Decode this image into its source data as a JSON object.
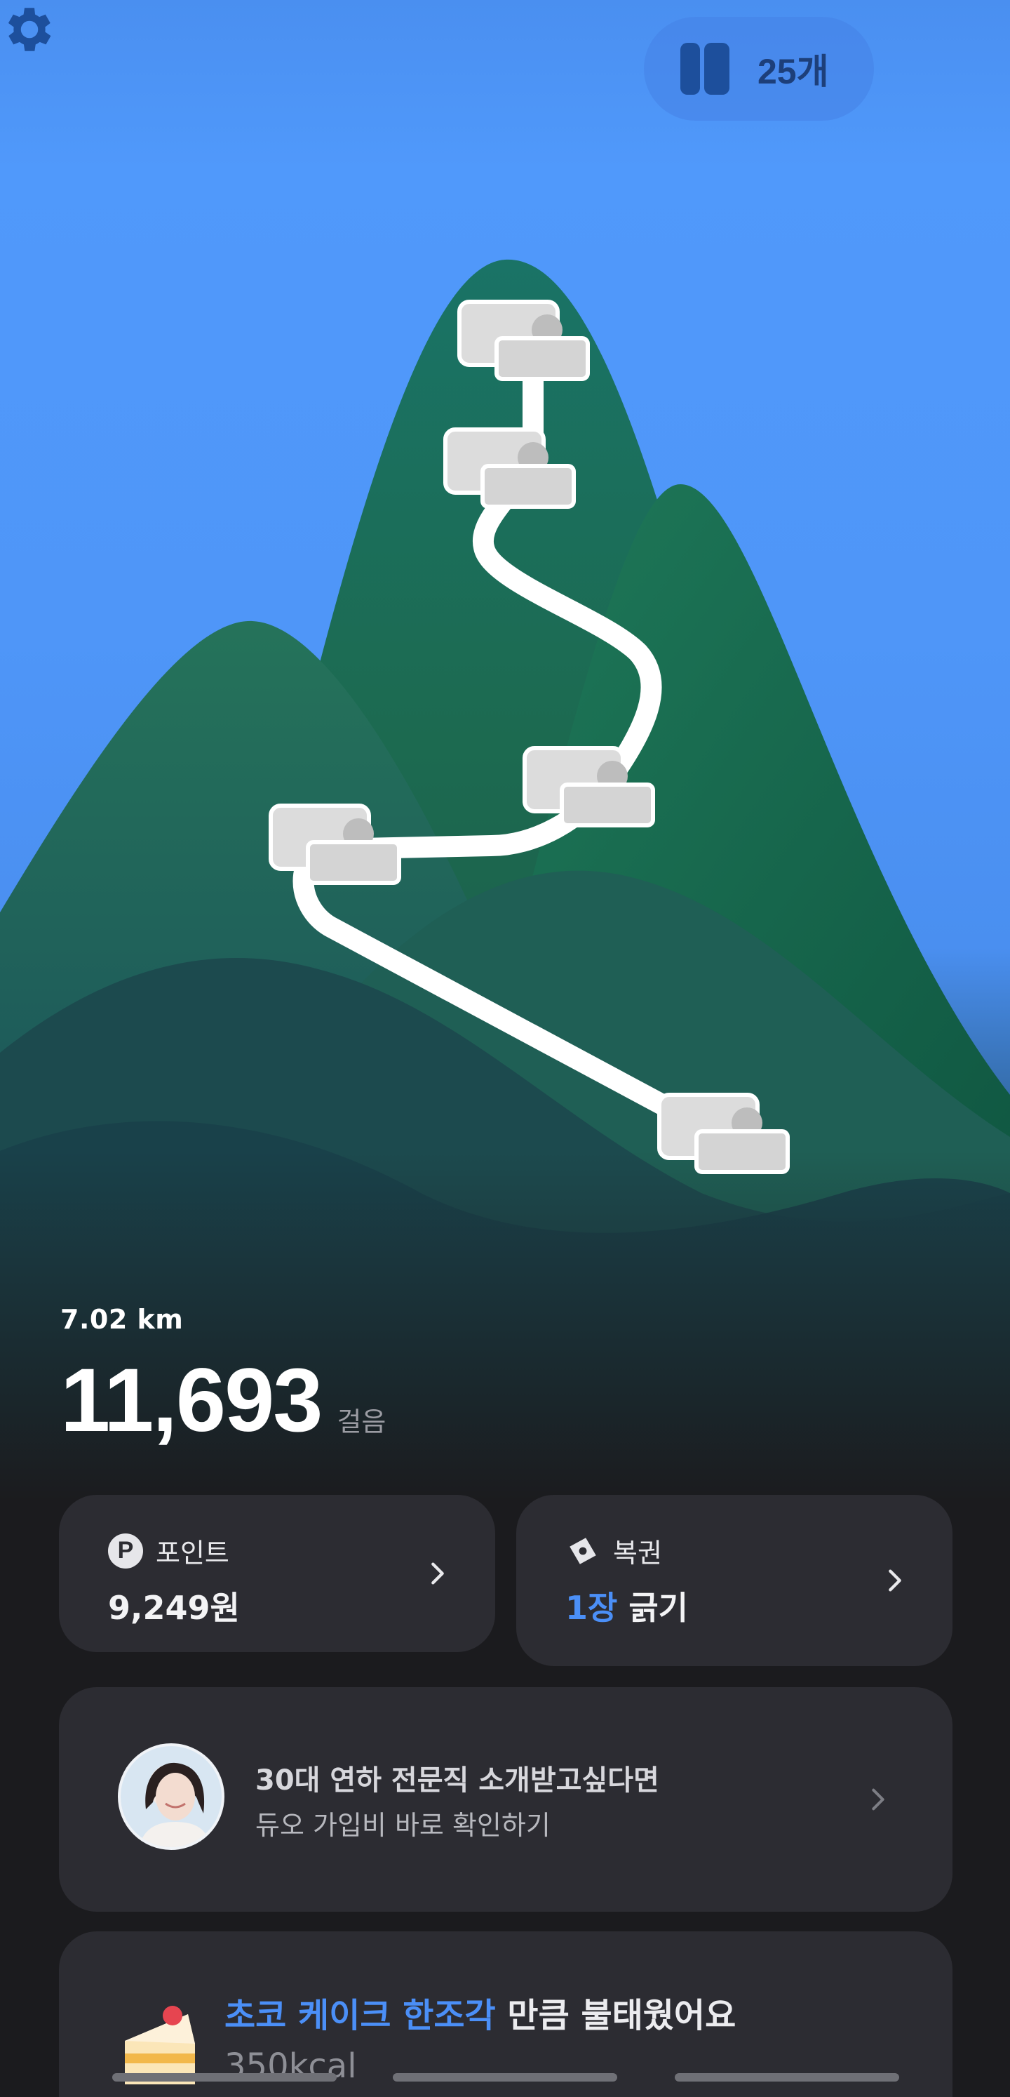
{
  "header": {
    "ticket_count": "25개",
    "icons": {
      "ticket": "ticket-stack-icon",
      "settings": "gear-icon"
    }
  },
  "activity": {
    "distance": "7.02 km",
    "steps": "11,693",
    "steps_unit": "걸음"
  },
  "points_card": {
    "icon": "point-badge-icon",
    "badge": "P",
    "label": "포인트",
    "value": "9,249원"
  },
  "lottery_card": {
    "icon": "lottery-ticket-icon",
    "label": "복권",
    "count": "1장",
    "action": "긁기"
  },
  "ad_card": {
    "title": "30대 연하 전문직 소개받고싶다면",
    "subtitle": "듀오 가입비 바로 확인하기"
  },
  "calorie_card": {
    "icon": "cake-icon",
    "food_highlight": "초코 케이크 한조각",
    "suffix": " 만큼 불태웠어요",
    "kcal": "350kcal"
  },
  "colors": {
    "sky": "#5099fb",
    "mountain": "#1f6b5a",
    "background": "#1b1b1e",
    "card": "#2c2c32",
    "accent": "#4b8ff7"
  }
}
